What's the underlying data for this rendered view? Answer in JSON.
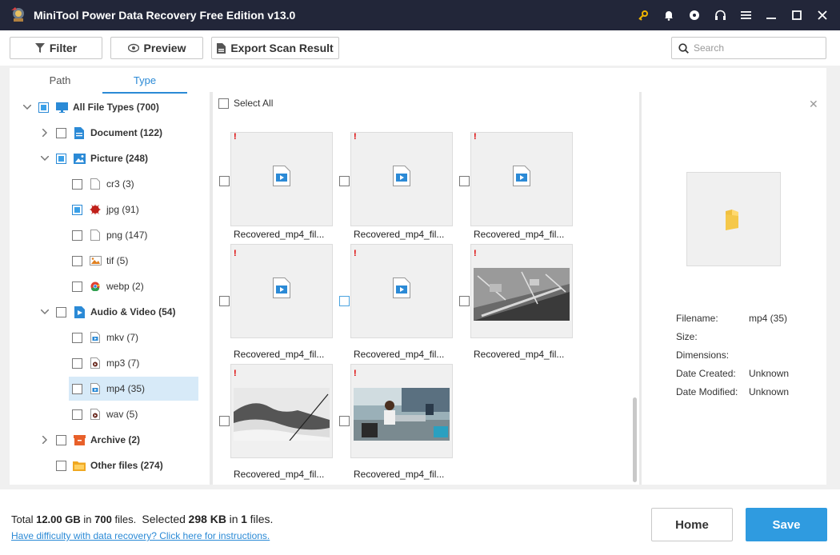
{
  "window": {
    "title": "MiniTool Power Data Recovery Free Edition v13.0",
    "icons": [
      "key-icon",
      "bell-icon",
      "disc-icon",
      "headset-icon",
      "menu-icon",
      "minimize-icon",
      "maximize-icon",
      "close-icon"
    ]
  },
  "toolbar": {
    "filter_label": "Filter",
    "preview_label": "Preview",
    "export_label": "Export Scan Result",
    "search_placeholder": "Search"
  },
  "tabs": {
    "path": "Path",
    "type": "Type",
    "active": "Type"
  },
  "tree": {
    "all_types": "All File Types (700)",
    "document": "Document (122)",
    "picture": "Picture (248)",
    "picture_children": {
      "cr3": "cr3 (3)",
      "jpg": "jpg (91)",
      "png": "png (147)",
      "tif": "tif (5)",
      "webp": "webp (2)"
    },
    "audio_video": "Audio & Video (54)",
    "av_children": {
      "mkv": "mkv (7)",
      "mp3": "mp3 (7)",
      "mp4": "mp4 (35)",
      "wav": "wav (5)"
    },
    "archive": "Archive (2)",
    "other": "Other files (274)"
  },
  "grid": {
    "select_all": "Select All",
    "items": [
      {
        "label": "Recovered_mp4_fil...",
        "kind": "video-placeholder"
      },
      {
        "label": "Recovered_mp4_fil...",
        "kind": "video-placeholder"
      },
      {
        "label": "Recovered_mp4_fil...",
        "kind": "video-placeholder"
      },
      {
        "label": "Recovered_mp4_fil...",
        "kind": "video-placeholder"
      },
      {
        "label": "Recovered_mp4_fil...",
        "kind": "video-placeholder"
      },
      {
        "label": "Recovered_mp4_fil...",
        "kind": "photo-street"
      },
      {
        "label": "Recovered_mp4_fil...",
        "kind": "photo-mountain"
      },
      {
        "label": "Recovered_mp4_fil...",
        "kind": "photo-office"
      }
    ]
  },
  "preview": {
    "labels": {
      "filename": "Filename:",
      "size": "Size:",
      "dimensions": "Dimensions:",
      "created": "Date Created:",
      "modified": "Date Modified:"
    },
    "values": {
      "filename": "mp4 (35)",
      "created": "Unknown",
      "modified": "Unknown"
    }
  },
  "footer": {
    "total_prefix": "Total",
    "total_size": "12.00 GB",
    "in_1": "in",
    "total_files": "700",
    "files_1": "files.",
    "selected_prefix": "Selected",
    "selected_size": "298 KB",
    "in_2": "in",
    "selected_files": "1",
    "files_2": "files.",
    "help_link": "Have difficulty with data recovery? Click here for instructions.",
    "home_label": "Home",
    "save_label": "Save"
  },
  "colors": {
    "titlebar": "#222639",
    "accent": "#2f9be0",
    "selection": "#d7eaf8"
  }
}
